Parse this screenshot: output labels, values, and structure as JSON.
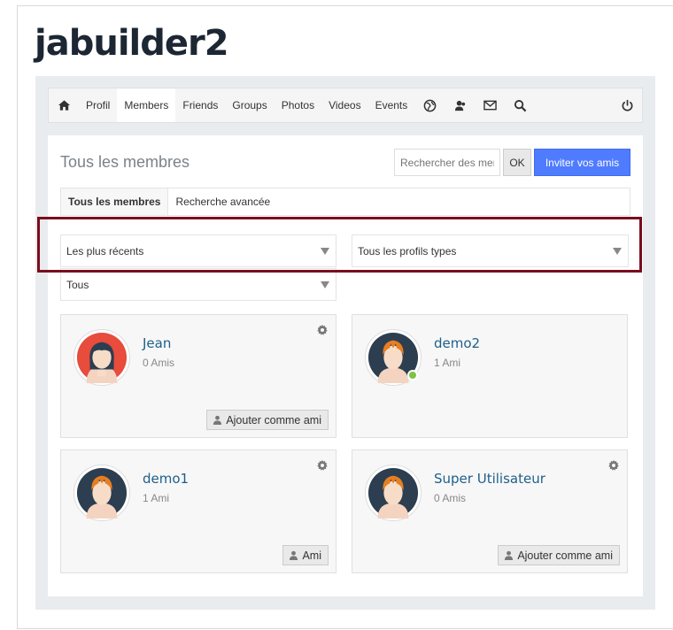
{
  "site": {
    "title": "jabuilder2"
  },
  "nav": {
    "items": [
      {
        "label": "Profil"
      },
      {
        "label": "Members"
      },
      {
        "label": "Friends"
      },
      {
        "label": "Groups"
      },
      {
        "label": "Photos"
      },
      {
        "label": "Videos"
      },
      {
        "label": "Events"
      }
    ]
  },
  "page": {
    "heading": "Tous les membres",
    "search_placeholder": "Rechercher des membres",
    "ok_label": "OK",
    "invite_label": "Inviter vos amis"
  },
  "tabs": [
    {
      "label": "Tous les membres"
    },
    {
      "label": "Recherche avancée"
    }
  ],
  "filters": {
    "sort": "Les plus récents",
    "profile_type": "Tous les profils types",
    "scope": "Tous"
  },
  "members": [
    {
      "name": "Jean",
      "friends": "0 Amis",
      "action": "Ajouter comme ami",
      "online": false
    },
    {
      "name": "demo2",
      "friends": "1 Ami",
      "action": "",
      "online": true
    },
    {
      "name": "demo1",
      "friends": "1 Ami",
      "action": "Ami",
      "online": false
    },
    {
      "name": "Super Utilisateur",
      "friends": "0 Amis",
      "action": "Ajouter comme ami",
      "online": false
    }
  ],
  "colors": {
    "accent": "#4f7cff",
    "link": "#1d5f8a",
    "highlight": "#7a0c1e",
    "online": "#7cc344"
  }
}
